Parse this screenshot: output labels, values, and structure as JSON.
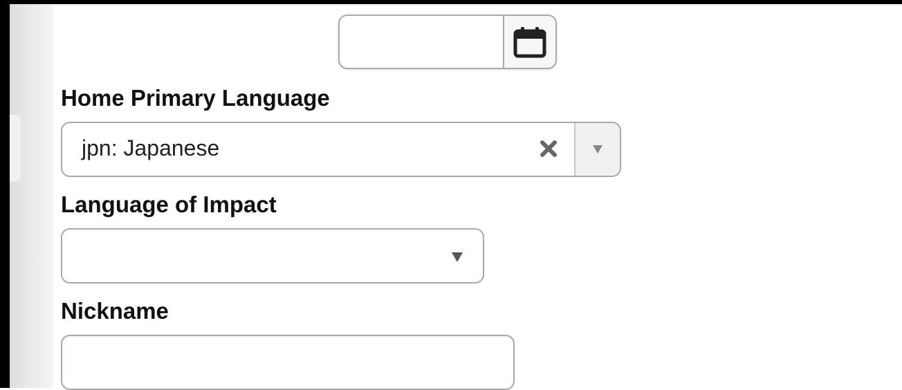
{
  "form": {
    "date_field": {
      "value": "",
      "icon": "calendar-icon"
    },
    "home_primary_language": {
      "label": "Home Primary Language",
      "selected_value": "jpn: Japanese",
      "clear_icon": "close-icon",
      "dropdown_icon": "caret-down-icon"
    },
    "language_of_impact": {
      "label": "Language of Impact",
      "selected_value": "",
      "dropdown_icon": "caret-down-icon"
    },
    "nickname": {
      "label": "Nickname",
      "value": ""
    }
  },
  "colors": {
    "border": "#a9a9a9",
    "label_text": "#111111",
    "gutter": "#e6e6e6"
  }
}
